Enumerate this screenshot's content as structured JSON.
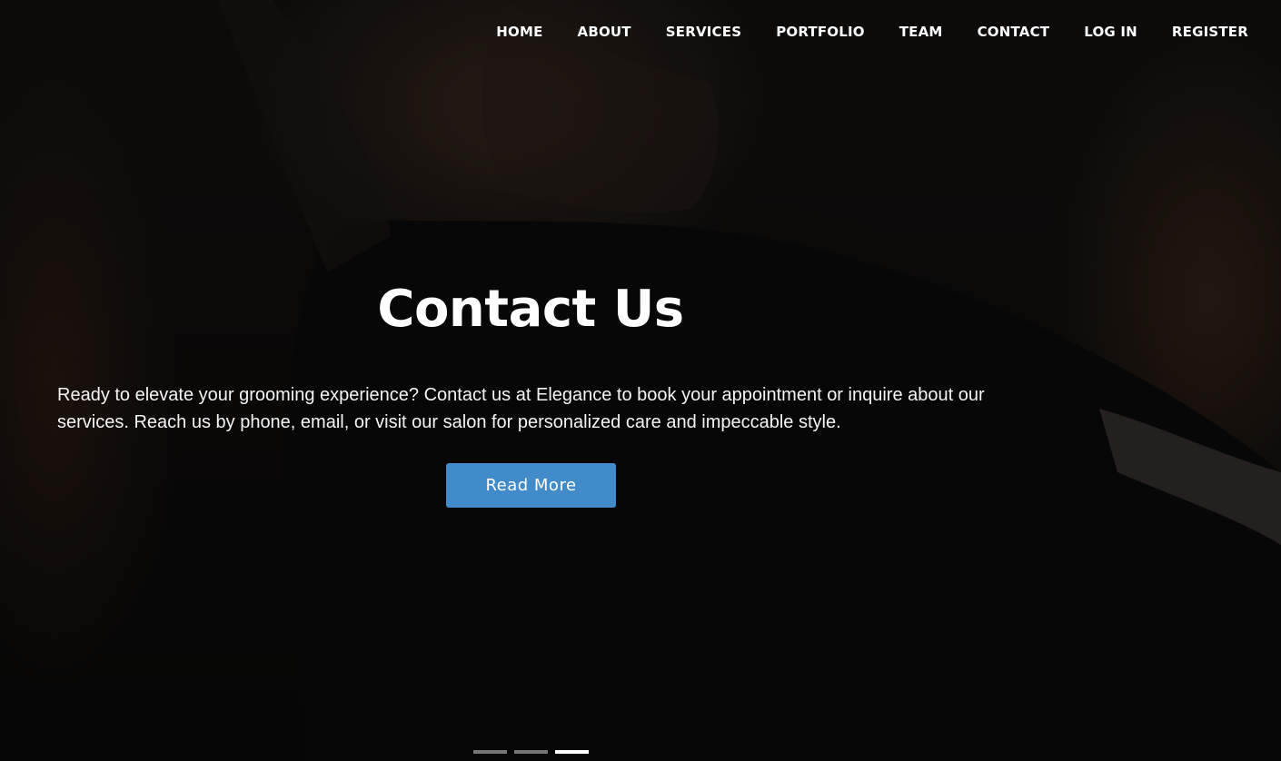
{
  "nav": {
    "items": [
      {
        "label": "HOME"
      },
      {
        "label": "ABOUT"
      },
      {
        "label": "SERVICES"
      },
      {
        "label": "PORTFOLIO"
      },
      {
        "label": "TEAM"
      },
      {
        "label": "CONTACT"
      },
      {
        "label": "LOG IN"
      },
      {
        "label": "REGISTER"
      }
    ]
  },
  "hero": {
    "title": "Contact Us",
    "text": "Ready to elevate your grooming experience? Contact us at Elegance to book your appointment or inquire about our services. Reach us by phone, email, or visit our salon for personalized care and impeccable style.",
    "button_label": "Read More",
    "button_color": "#428bca",
    "slides": {
      "count": 3,
      "active": 3
    }
  }
}
